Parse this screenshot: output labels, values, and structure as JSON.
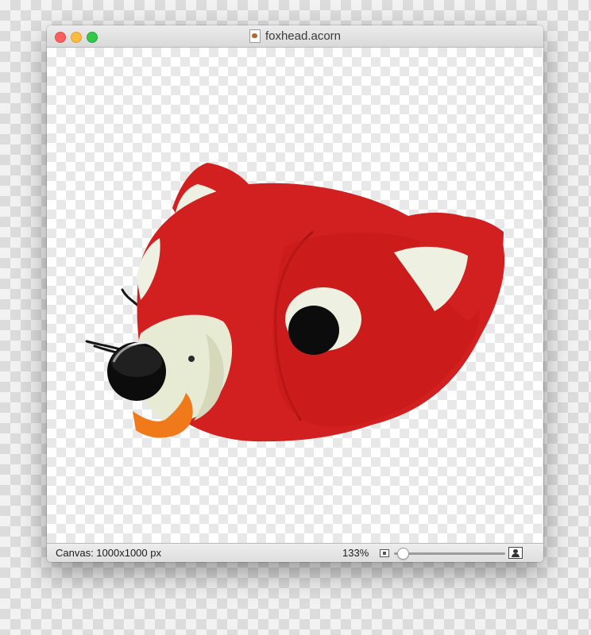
{
  "window": {
    "title": "foxhead.acorn",
    "document_icon": "acorn-document-icon"
  },
  "traffic_lights": {
    "close_color": "#fc605c",
    "minimize_color": "#fdbc40",
    "zoom_color": "#34c84a"
  },
  "canvas": {
    "image_subject": "felt-fox-head"
  },
  "status": {
    "canvas_size": "Canvas: 1000x1000 px",
    "zoom": "133%",
    "zoom_slider_fraction": 0.05,
    "zoom_out_icon": "small-image-icon",
    "zoom_in_icon": "large-image-icon"
  },
  "colors": {
    "felt_red": "#d21f1f",
    "felt_light": "#eef0e2",
    "felt_orange": "#f07a1a",
    "button_black": "#0c0c0c"
  }
}
